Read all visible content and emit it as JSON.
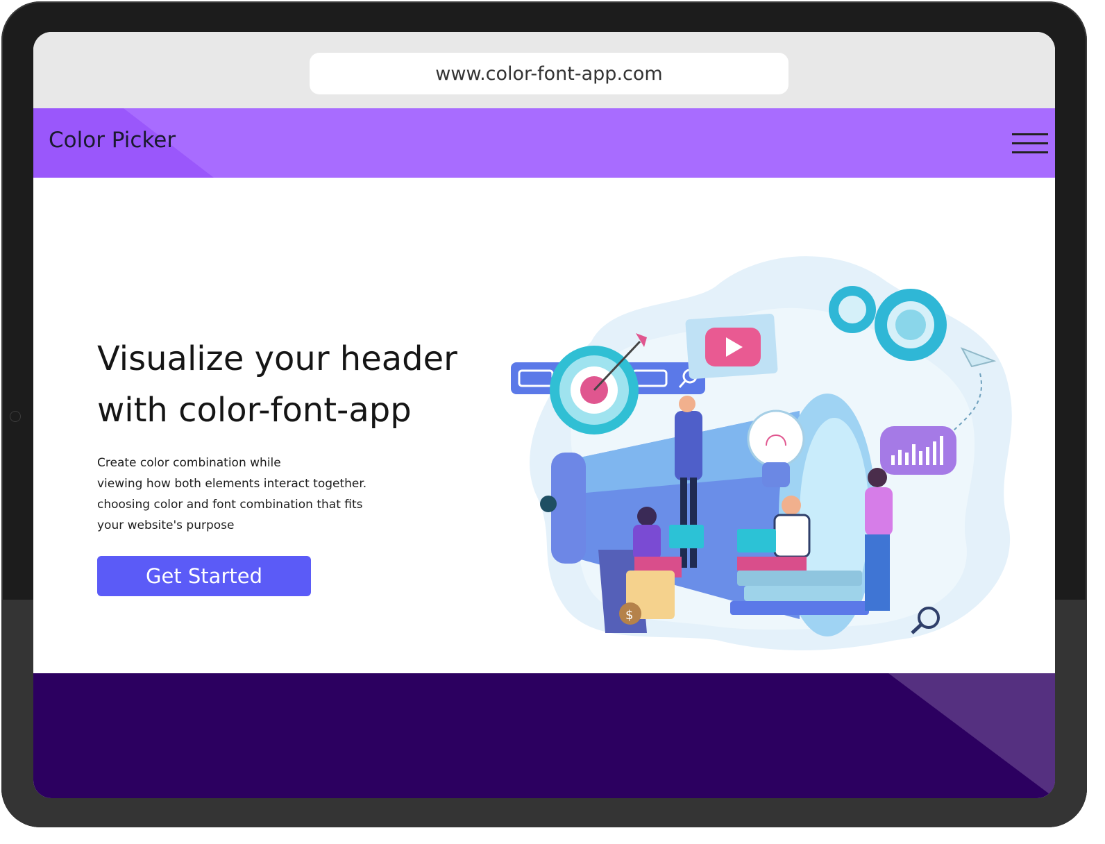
{
  "browser": {
    "url": "www.color-font-app.com"
  },
  "navbar": {
    "brand": "Color Picker",
    "background_color": "#a86cff"
  },
  "hero": {
    "headline_lines": [
      "Visualize your header",
      "with color-font-app"
    ],
    "description_lines": [
      "Create color combination while",
      "viewing how both elements interact together.",
      "choosing color and font combination that fits",
      "your website's purpose"
    ],
    "cta_label": "Get Started",
    "cta_color": "#5b5bf7"
  },
  "footer": {
    "background_color": "#2c0060"
  },
  "icons": [
    "hamburger-menu-icon",
    "search-icon",
    "play-icon",
    "gear-icon",
    "lightbulb-icon",
    "megaphone-icon",
    "target-icon",
    "paper-plane-icon",
    "magnifier-icon",
    "money-bag-icon"
  ]
}
